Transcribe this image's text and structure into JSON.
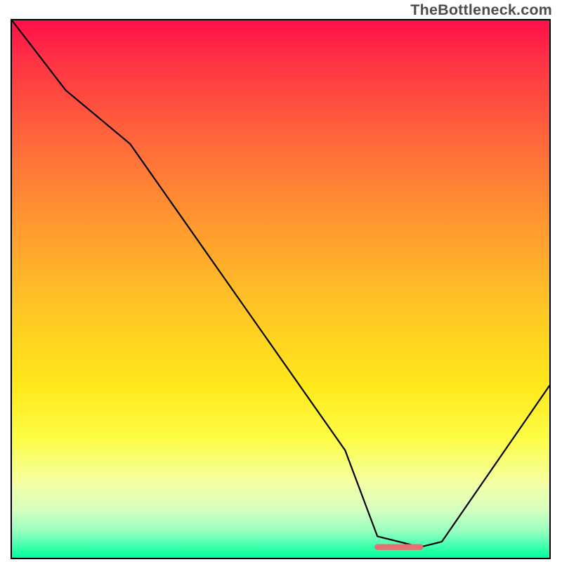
{
  "watermark": "TheBottleneck.com",
  "chart_data": {
    "type": "line",
    "title": "",
    "xlabel": "",
    "ylabel": "",
    "xlim": [
      0,
      100
    ],
    "ylim": [
      0,
      100
    ],
    "series": [
      {
        "name": "curve",
        "x": [
          0,
          10,
          22,
          62,
          68,
          76,
          80,
          100
        ],
        "y": [
          100,
          87,
          77,
          20,
          4,
          2,
          3,
          32
        ]
      }
    ],
    "marker": {
      "name": "bottleneck-flat-segment",
      "x": [
        68,
        76
      ],
      "y": [
        2,
        2
      ],
      "color": "#e77070",
      "thickness": 2.3
    },
    "background_gradient": {
      "direction": "vertical",
      "stops": [
        {
          "pos": 0.0,
          "color": "#ff0f4a"
        },
        {
          "pos": 0.08,
          "color": "#ff3444"
        },
        {
          "pos": 0.23,
          "color": "#ff6a3a"
        },
        {
          "pos": 0.38,
          "color": "#ff9930"
        },
        {
          "pos": 0.53,
          "color": "#ffc425"
        },
        {
          "pos": 0.68,
          "color": "#ffe91b"
        },
        {
          "pos": 0.78,
          "color": "#fdfd47"
        },
        {
          "pos": 0.86,
          "color": "#f4ffa3"
        },
        {
          "pos": 0.91,
          "color": "#d7ffc0"
        },
        {
          "pos": 0.95,
          "color": "#97ffbf"
        },
        {
          "pos": 0.975,
          "color": "#4affb1"
        },
        {
          "pos": 1.0,
          "color": "#00ff9a"
        }
      ]
    }
  }
}
